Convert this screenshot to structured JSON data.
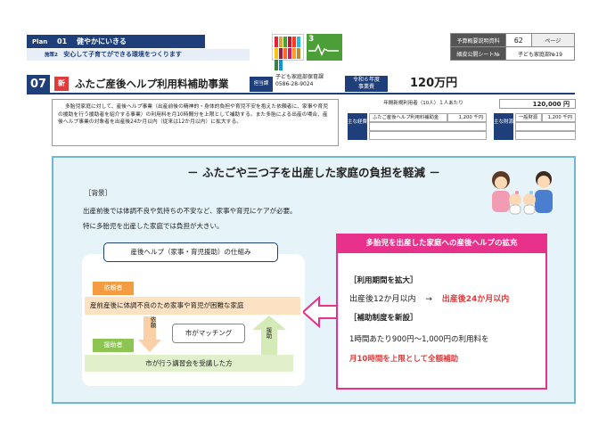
{
  "header": {
    "plan_label": "Plan",
    "plan_num": "01",
    "plan_title": "健やかにいきる",
    "sub_label": "施策2",
    "sub_title": "安心して子育てができる環境をつくります",
    "sdg_text": "3",
    "ref": {
      "row1_label": "予算概要説明資料",
      "row1_value": "62",
      "row1_unit": "ページ",
      "row2_label": "細皮公開シート№",
      "row2_value": "子ども家庭部№19"
    }
  },
  "project": {
    "number": "07",
    "new_badge": "新",
    "title": "ふたご産後ヘルプ利用料補助事業",
    "dept_label": "担当課",
    "dept_name": "子ども家庭部保育課",
    "dept_phone": "0586-28-9024",
    "year_label_1": "令和６年度",
    "year_label_2": "事業費",
    "budget": "120万円"
  },
  "description": "多胎児家庭に対して、産後ヘルプ事業（出産前後の精神的・身体的負担や育児不安を抱えた依頼者に、家事や育児の援助を行う援助者を紹介する事業）の利用料を月10時間分を上限として補助する。また多胎による出産の場合、産後ヘルプ事業の対象者を出産後24か月以内（従来は12か月以内）に拡大する。",
  "metrics": {
    "usage_title": "年間新規利用者（10人）１人あたり",
    "usage_value": "120,000 円",
    "expense_label": "主な経費",
    "expense_item": "ふたご産後ヘルプ利用料補助金",
    "expense_amount": "1,200 千円",
    "fund_label": "主な財源",
    "fund_item": "一般財源",
    "fund_amount": "1,200 千円"
  },
  "panel": {
    "title": "－ ふたごや三つ子を出産した家庭の負担を軽減 －",
    "bg_heading": "［背景］",
    "bg_line1": "出産前後では体調不良や気持ちの不安など、家事や育児にケアが必要。",
    "bg_line2": "特に多胎児を出産した家庭では負担が大きい。",
    "mech_title": "産後ヘルプ（家事・育児援助）の仕組み",
    "irai_label": "依頼者",
    "irai_desc": "産前産後に体調不良のため家事や育児が困難な家庭",
    "enjo_label": "援助者",
    "enjo_desc": "市が行う講習会を受講した方",
    "match_label": "市がマッチング",
    "arrow_down_label": "依頼",
    "arrow_up_label": "援助",
    "red_head": "多胎児を出産した家庭への産後ヘルプの拡充",
    "red_h1": "［利用期間を拡大］",
    "red_period_old": "出産後12か月以内",
    "red_arrow": "→",
    "red_period_new": "出産後24か月以内",
    "red_h2": "［補助制度を新設］",
    "red_line1": "1時間あたり900円～1,000円の利用料を",
    "red_line2": "月10時間を上限として全額補助"
  },
  "colors": {
    "navy": "#1f3f7a",
    "pink": "#e8318a",
    "orange": "#f39c41",
    "green": "#8dc552",
    "red_text": "#e03a3a"
  }
}
